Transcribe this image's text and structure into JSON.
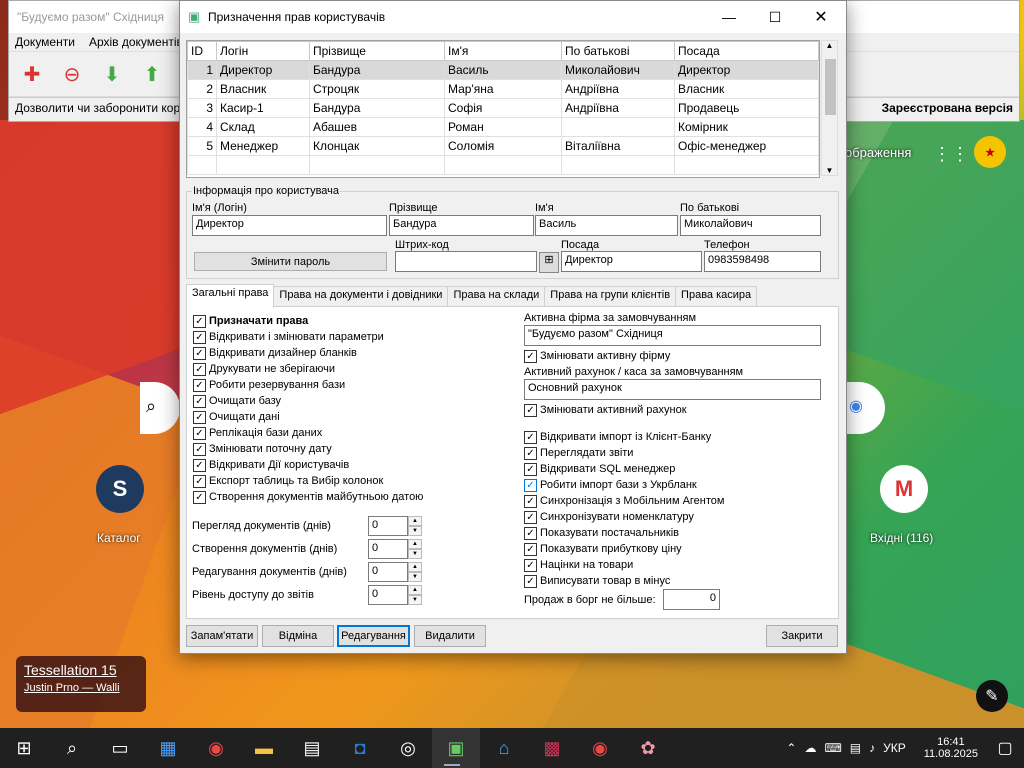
{
  "desktop": {
    "bg_window": {
      "title": "\"Будуємо разом\" Східниця",
      "menu": [
        "Документи",
        "Архів документів"
      ],
      "status_left": "Дозволити чи заборонити користувачу",
      "status_right": "Зареєстрована версія"
    },
    "shortcuts": {
      "catalog": "Каталог",
      "inbox": "Вхідні (116)",
      "images": "ображення"
    },
    "wallpaper_card": {
      "title": "Tessellation 15",
      "author": "Justin Prno — Walli"
    }
  },
  "dialog": {
    "title": "Призначення прав користувачів",
    "grid": {
      "columns": [
        "ID",
        "Логін",
        "Прізвище",
        "Ім'я",
        "По батькові",
        "Посада"
      ],
      "rows": [
        [
          "1",
          "Директор",
          "Бандура",
          "Василь",
          "Миколайович",
          "Директор"
        ],
        [
          "2",
          "Власник",
          "Строцяк",
          "Мар'яна",
          "Андріївна",
          "Власник"
        ],
        [
          "3",
          "Касир-1",
          "Бандура",
          "Софія",
          "Андріївна",
          "Продавець"
        ],
        [
          "4",
          "Склад",
          "Абашев",
          "Роман",
          "",
          "Комірник"
        ],
        [
          "5",
          "Менеджер",
          "Клонцак",
          "Соломія",
          "Віталіївна",
          "Офіс-менеджер"
        ]
      ],
      "selected_row": 0
    },
    "info": {
      "group_title": "Інформація про користувача",
      "login_label": "Ім'я (Логін)",
      "login": "Директор",
      "surname_label": "Прізвище",
      "surname": "Бандура",
      "name_label": "Ім'я",
      "name": "Василь",
      "patronymic_label": "По батькові",
      "patronymic": "Миколайович",
      "change_password": "Змінити пароль",
      "barcode_label": "Штрих-код",
      "barcode": "",
      "position_label": "Посада",
      "position": "Директор",
      "phone_label": "Телефон",
      "phone": "0983598498"
    },
    "tabs": [
      "Загальні права",
      "Права на документи і довідники",
      "Права на склади",
      "Права на групи клієнтів",
      "Права касира"
    ],
    "left_checks": [
      {
        "label": "Призначати права",
        "bold": true
      },
      {
        "label": "Відкривати і змінювати параметри"
      },
      {
        "label": "Відкривати дизайнер бланків"
      },
      {
        "label": "Друкувати не зберігаючи"
      },
      {
        "label": "Робити резервування бази"
      },
      {
        "label": "Очищати базу"
      },
      {
        "label": "Очищати дані"
      },
      {
        "label": "Реплікація бази даних"
      },
      {
        "label": "Змінювати поточну дату"
      },
      {
        "label": "Відкривати Дії користувачів"
      },
      {
        "label": "Експорт таблиць та Вибір колонок"
      },
      {
        "label": "Створення документів майбутньою датою"
      }
    ],
    "spinners": [
      {
        "label": "Перегляд документів (днів)",
        "value": "0"
      },
      {
        "label": "Створення документів (днів)",
        "value": "0"
      },
      {
        "label": "Редагування документів (днів)",
        "value": "0"
      },
      {
        "label": "Рівень доступу до звітів",
        "value": "0"
      }
    ],
    "right": {
      "firm_label": "Активна фірма за замовчуванням",
      "firm": "\"Будуємо разом\" Східниця",
      "change_firm": "Змінювати активну фірму",
      "account_label": "Активний рахунок / каса за замовчуванням",
      "account": "Основний рахунок",
      "change_account": "Змінювати активний рахунок",
      "checks": [
        "Відкривати імпорт із Клієнт-Банку",
        "Переглядати звіти",
        "Відкривати SQL менеджер",
        "Робити імпорт бази з Укрбланк",
        "Синхронізація з Мобільним Агентом",
        "Синхронізувати номенклатуру",
        "Показувати постачальників",
        "Показувати прибуткову ціну",
        "Націнки на товари",
        "Виписувати товар в мінус"
      ],
      "debt_label": "Продаж в борг не більше:",
      "debt": "0"
    },
    "buttons": {
      "save": "Запам'ятати",
      "cancel": "Відміна",
      "edit": "Редагування",
      "delete": "Видалити",
      "close": "Закрити"
    }
  },
  "taskbar": {
    "lang": "УКР",
    "time": "16:41",
    "date": "11.08.2025"
  }
}
